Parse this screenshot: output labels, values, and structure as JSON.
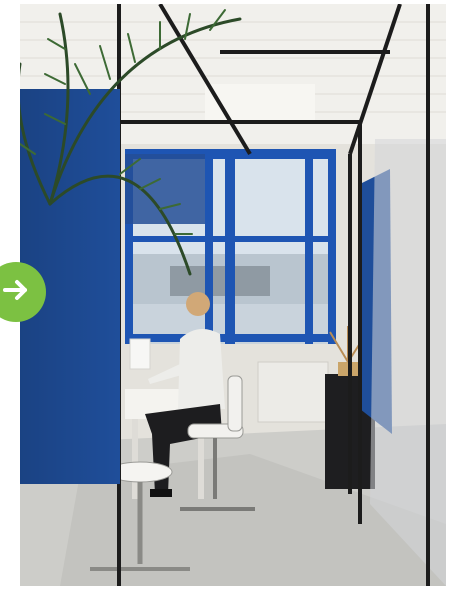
{
  "image": {
    "subject": "office-interior-photo",
    "alt": ""
  },
  "colors": {
    "arrow_button": "#7cc142",
    "acoustic_panel": "#1f4e9a",
    "window_frame": "#1e55b3",
    "steel_frame": "#1c1c1c"
  },
  "icons": {
    "next": "arrow-right-icon"
  }
}
